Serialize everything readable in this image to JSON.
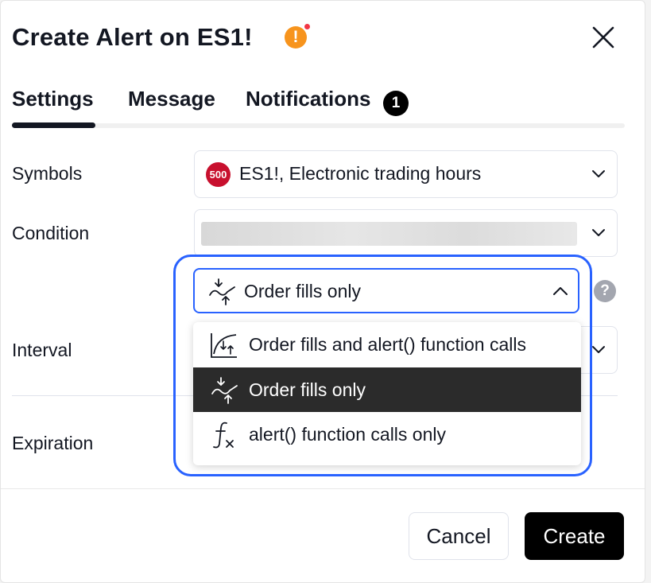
{
  "dialog": {
    "title": "Create Alert on ES1!",
    "warning_icon": "exclamation-icon",
    "warning_glyph": "!",
    "close_icon": "close-icon"
  },
  "tabs": [
    {
      "label": "Settings",
      "active": true
    },
    {
      "label": "Message",
      "active": false
    },
    {
      "label": "Notifications",
      "active": false,
      "badge": "1"
    }
  ],
  "form": {
    "symbols": {
      "label": "Symbols",
      "badge": "500",
      "value": "ES1!, Electronic trading hours"
    },
    "condition": {
      "label": "Condition"
    },
    "trigger": {
      "selected": "Order fills only",
      "help_glyph": "?",
      "options": [
        {
          "label": "Order fills and alert() function calls",
          "icon": "order-fills-and-calls-icon",
          "selected": false
        },
        {
          "label": "Order fills only",
          "icon": "order-fills-icon",
          "selected": true
        },
        {
          "label": "alert() function calls only",
          "icon": "function-fx-icon",
          "selected": false
        }
      ]
    },
    "interval": {
      "label": "Interval"
    },
    "expiration": {
      "label": "Expiration"
    }
  },
  "footer": {
    "cancel": "Cancel",
    "create": "Create"
  },
  "colors": {
    "accent": "#2962ff",
    "badge_red": "#c8102e",
    "warning": "#f7941d",
    "selected_row": "#2b2b2b"
  }
}
